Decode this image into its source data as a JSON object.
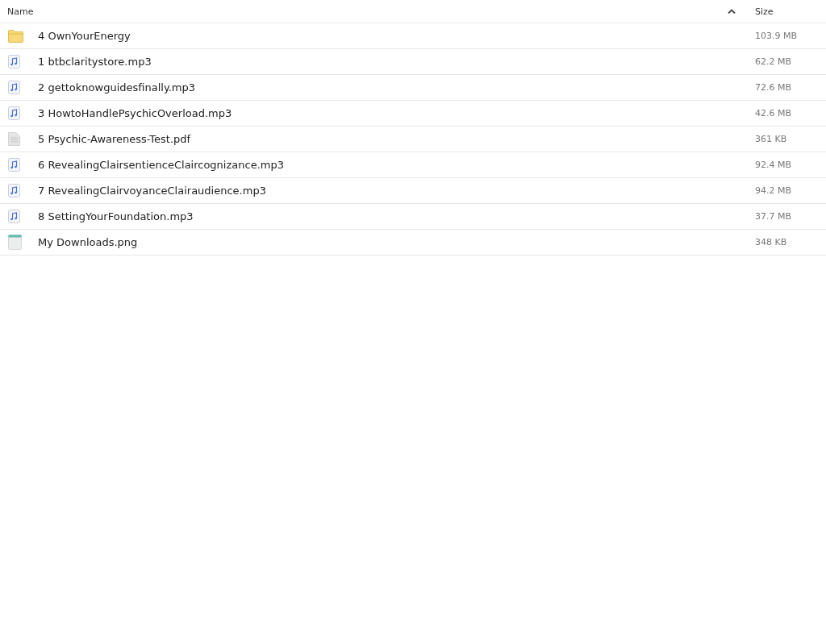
{
  "table": {
    "columns": [
      {
        "label": "Name",
        "sorted": true
      },
      {
        "label": "Size",
        "sorted": false
      }
    ],
    "rows": [
      {
        "kind": "folder",
        "name": "4 OwnYourEnergy",
        "size": "103.9 MB"
      },
      {
        "kind": "audio",
        "name": "1 btbclaritystore.mp3",
        "size": "62.2 MB"
      },
      {
        "kind": "audio",
        "name": "2 gettoknowguidesfinally.mp3",
        "size": "72.6 MB"
      },
      {
        "kind": "audio",
        "name": "3 HowtoHandlePsychicOverload.mp3",
        "size": "42.6 MB"
      },
      {
        "kind": "document",
        "name": "5 Psychic-Awareness-Test.pdf",
        "size": "361 KB"
      },
      {
        "kind": "audio",
        "name": "6 RevealingClairsentienceClaircognizance.mp3",
        "size": "92.4 MB"
      },
      {
        "kind": "audio",
        "name": "7 RevealingClairvoyanceClairaudience.mp3",
        "size": "94.2 MB"
      },
      {
        "kind": "audio",
        "name": "8 SettingYourFoundation.mp3",
        "size": "37.7 MB"
      },
      {
        "kind": "image",
        "name": "My Downloads.png",
        "size": "348 KB"
      }
    ]
  }
}
